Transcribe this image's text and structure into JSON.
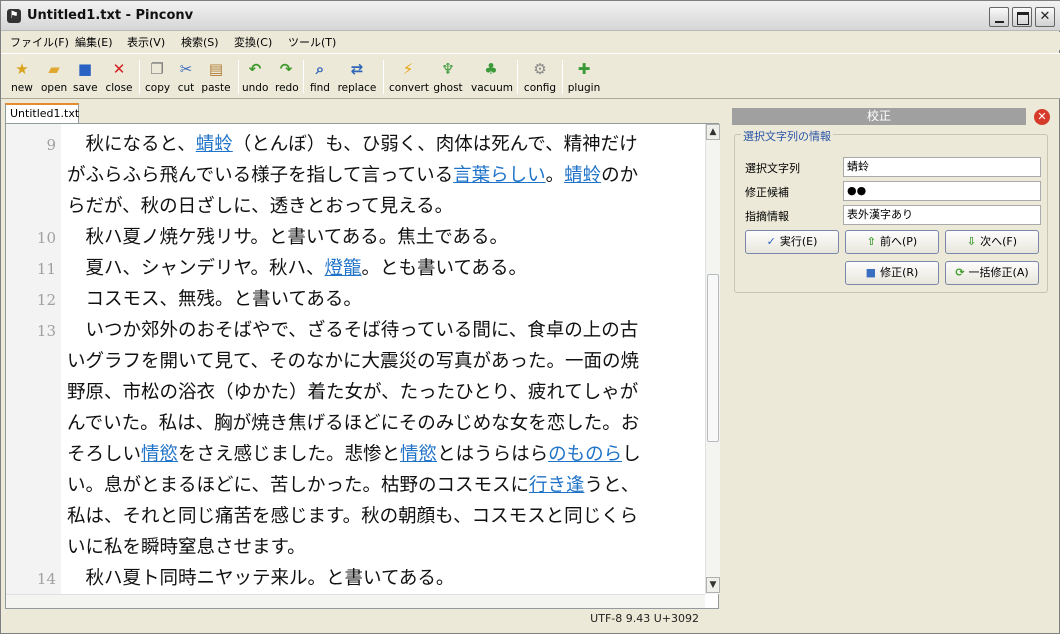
{
  "window": {
    "title": "Untitled1.txt - Pinconv"
  },
  "menu": [
    "ファイル(F)",
    "編集(E)",
    "表示(V)",
    "検索(S)",
    "変換(C)",
    "ツール(T)"
  ],
  "toolbar": [
    {
      "label": "new",
      "icon": "new-file-icon",
      "glyph": "★",
      "color": "#d9a21a"
    },
    {
      "label": "open",
      "icon": "open-folder-icon",
      "glyph": "▰",
      "color": "#e0a830"
    },
    {
      "label": "save",
      "icon": "save-disk-icon",
      "glyph": "■",
      "color": "#2a62c4"
    },
    {
      "label": "close",
      "icon": "close-x-icon",
      "glyph": "✕",
      "color": "#d42020"
    },
    {
      "label": "copy",
      "icon": "copy-icon",
      "glyph": "❐",
      "color": "#7a7a7a"
    },
    {
      "label": "cut",
      "icon": "scissors-icon",
      "glyph": "✂",
      "color": "#3a6ec0"
    },
    {
      "label": "paste",
      "icon": "paste-clipboard-icon",
      "glyph": "▤",
      "color": "#b07c34"
    },
    {
      "label": "undo",
      "icon": "undo-arrow-icon",
      "glyph": "↶",
      "color": "#3d9a2a"
    },
    {
      "label": "redo",
      "icon": "redo-arrow-icon",
      "glyph": "↷",
      "color": "#3d9a2a"
    },
    {
      "label": "find",
      "icon": "magnifier-icon",
      "glyph": "⌕",
      "color": "#2f66b8"
    },
    {
      "label": "replace",
      "icon": "replace-icon",
      "glyph": "⇄",
      "color": "#2f66b8"
    },
    {
      "label": "convert",
      "icon": "lightning-icon",
      "glyph": "⚡",
      "color": "#e8a310"
    },
    {
      "label": "ghost",
      "icon": "ghost-icon",
      "glyph": "♆",
      "color": "#3a9a38"
    },
    {
      "label": "vacuum",
      "icon": "vacuum-icon",
      "glyph": "♣",
      "color": "#3a9a38"
    },
    {
      "label": "config",
      "icon": "gear-icon",
      "glyph": "⚙",
      "color": "#888888"
    },
    {
      "label": "plugin",
      "icon": "puzzle-icon",
      "glyph": "✚",
      "color": "#3a9a38"
    }
  ],
  "tab": {
    "label": "Untitled1.txt"
  },
  "editor": {
    "lines": [
      {
        "num": "9",
        "segments": [
          {
            "t": "　秋になると、"
          },
          {
            "t": "蜻蛉",
            "err": true
          },
          {
            "t": "（とんぼ）も、ひ弱く、肉体は死んで、精神だけ"
          }
        ]
      },
      {
        "num": "",
        "segments": [
          {
            "t": "がふらふら飛んでいる様子を指して言っている"
          },
          {
            "t": "言葉らしい",
            "err": true
          },
          {
            "t": "。"
          },
          {
            "t": "蜻蛉",
            "err": true
          },
          {
            "t": "のか"
          }
        ]
      },
      {
        "num": "",
        "segments": [
          {
            "t": "らだが、秋の日ざしに、透きとおって見える。"
          }
        ]
      },
      {
        "num": "10",
        "segments": [
          {
            "t": "　秋ハ夏ノ焼ケ残リサ。と書いてある。焦土である。"
          }
        ]
      },
      {
        "num": "11",
        "segments": [
          {
            "t": "　夏ハ、シャンデリヤ。秋ハ、"
          },
          {
            "t": "燈籠",
            "err": true
          },
          {
            "t": "。とも書いてある。"
          }
        ]
      },
      {
        "num": "12",
        "segments": [
          {
            "t": "　コスモス、無残。と書いてある。"
          }
        ]
      },
      {
        "num": "13",
        "segments": [
          {
            "t": "　いつか郊外のおそばやで、ざるそば待っている間に、食卓の上の古"
          }
        ]
      },
      {
        "num": "",
        "segments": [
          {
            "t": "いグラフを開いて見て、そのなかに大震災の写真があった。一面の焼"
          }
        ]
      },
      {
        "num": "",
        "segments": [
          {
            "t": "野原、市松の浴衣（ゆかた）着た女が、たったひとり、疲れてしゃが"
          }
        ]
      },
      {
        "num": "",
        "segments": [
          {
            "t": "んでいた。私は、胸が焼き焦げるほどにそのみじめな女を恋した。お"
          }
        ]
      },
      {
        "num": "",
        "segments": [
          {
            "t": "そろしい"
          },
          {
            "t": "情慾",
            "err": true
          },
          {
            "t": "をさえ感じました。悲惨と"
          },
          {
            "t": "情慾",
            "err": true
          },
          {
            "t": "とはうらはら"
          },
          {
            "t": "のものら",
            "err": true
          },
          {
            "t": "し"
          }
        ]
      },
      {
        "num": "",
        "segments": [
          {
            "t": "い。息がとまるほどに、苦しかった。枯野のコスモスに"
          },
          {
            "t": "行き逢",
            "err": true
          },
          {
            "t": "うと、"
          }
        ]
      },
      {
        "num": "",
        "segments": [
          {
            "t": "私は、それと同じ痛苦を感じます。秋の朝顔も、コスモスと同じくら"
          }
        ]
      },
      {
        "num": "",
        "segments": [
          {
            "t": "いに私を瞬時窒息させます。"
          }
        ]
      },
      {
        "num": "14",
        "segments": [
          {
            "t": "　秋ハ夏ト同時ニヤッテ来ル。と書いてある。"
          }
        ]
      }
    ]
  },
  "status": {
    "text": "UTF-8  9.43  U+3092"
  },
  "panel": {
    "title": "校正",
    "group_label": "選択文字列の情報",
    "fields": [
      {
        "label": "選択文字列",
        "value": "蜻蛉"
      },
      {
        "label": "修正候補",
        "value": "●●"
      },
      {
        "label": "指摘情報",
        "value": "表外漢字あり"
      }
    ],
    "buttons": {
      "execute": "実行(E)",
      "prev": "前へ(P)",
      "next": "次へ(F)",
      "fix": "修正(R)",
      "fix_all": "一括修正(A)"
    }
  },
  "colors": {
    "error_link": "#1f73c8",
    "panel_close": "#d63a2a",
    "tab_accent": "#e68b2c"
  }
}
